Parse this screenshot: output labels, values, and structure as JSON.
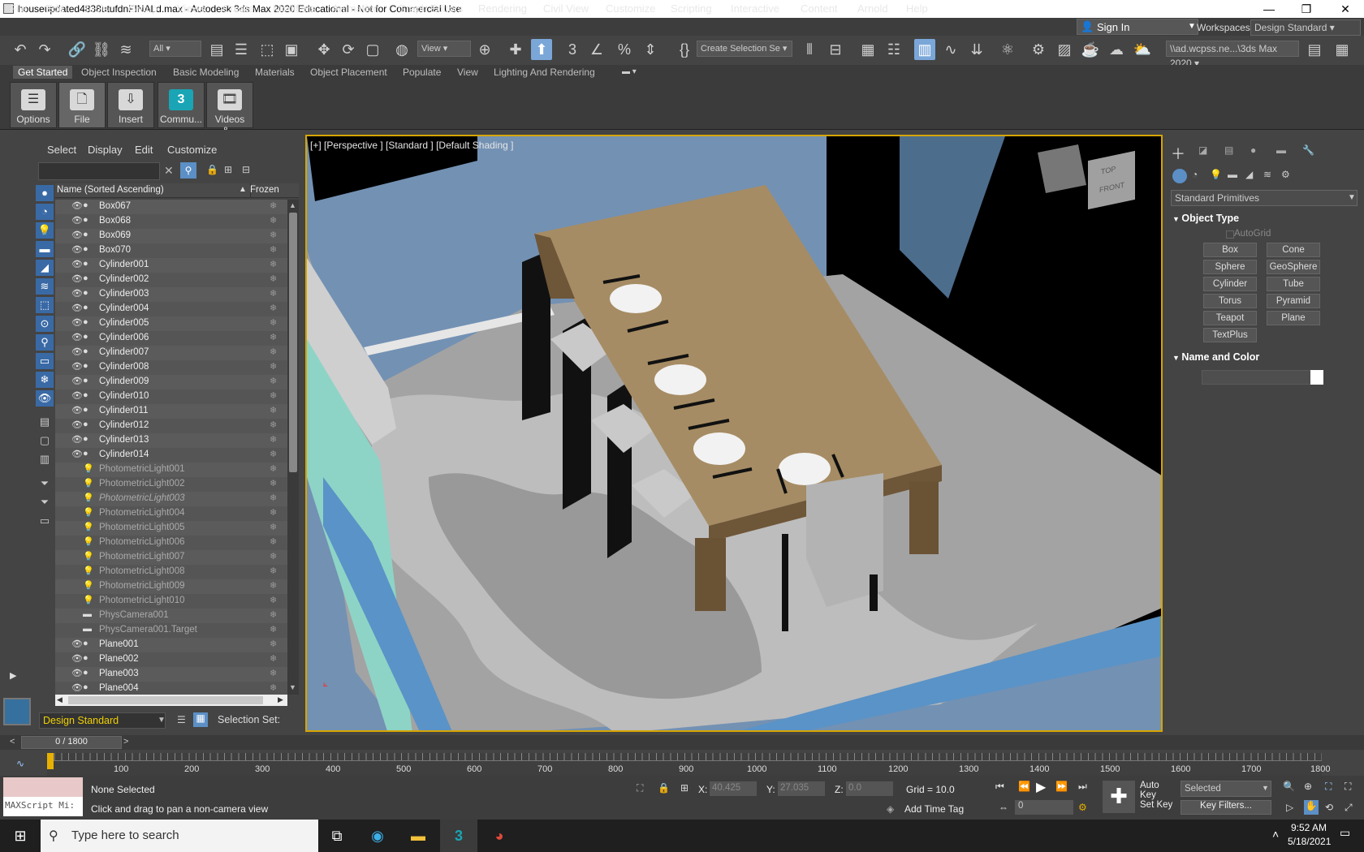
{
  "window": {
    "title": "houseupdated4838utufdnFINALd.max - Autodesk 3ds Max 2020 Educational - Not for Commercial Use"
  },
  "menu": [
    "File",
    "Edit",
    "Tools",
    "Group",
    "Views",
    "Create",
    "Modifiers",
    "Animation",
    "Graph Editors",
    "Rendering",
    "Civil View",
    "Customize",
    "Scripting",
    "Interactive",
    "Content",
    "Arnold",
    "Help"
  ],
  "account": {
    "signin": "Sign In",
    "workspaces_label": "Workspaces:",
    "workspace": "Design Standard"
  },
  "toolbar": {
    "selection_filter": "All",
    "ref_coord": "View",
    "named_selection": "Create Selection Se",
    "project_path": "\\\\ad.wcpss.ne...\\3ds Max 2020"
  },
  "ribbon": {
    "tabs": [
      "Get Started",
      "Object Inspection",
      "Basic Modeling",
      "Materials",
      "Object Placement",
      "Populate",
      "View",
      "Lighting And Rendering"
    ],
    "buttons": [
      "Options",
      "File",
      "Insert",
      "Commu...",
      "Videos &..."
    ]
  },
  "scene_explorer": {
    "tabs": [
      "Select",
      "Display",
      "Edit",
      "Customize"
    ],
    "col_name": "Name (Sorted Ascending)",
    "col_frozen": "Frozen",
    "rows": [
      {
        "name": "Box067",
        "type": "geo"
      },
      {
        "name": "Box068",
        "type": "geo"
      },
      {
        "name": "Box069",
        "type": "geo"
      },
      {
        "name": "Box070",
        "type": "geo"
      },
      {
        "name": "Cylinder001",
        "type": "geo"
      },
      {
        "name": "Cylinder002",
        "type": "geo"
      },
      {
        "name": "Cylinder003",
        "type": "geo"
      },
      {
        "name": "Cylinder004",
        "type": "geo"
      },
      {
        "name": "Cylinder005",
        "type": "geo"
      },
      {
        "name": "Cylinder006",
        "type": "geo"
      },
      {
        "name": "Cylinder007",
        "type": "geo"
      },
      {
        "name": "Cylinder008",
        "type": "geo"
      },
      {
        "name": "Cylinder009",
        "type": "geo"
      },
      {
        "name": "Cylinder010",
        "type": "geo"
      },
      {
        "name": "Cylinder011",
        "type": "geo"
      },
      {
        "name": "Cylinder012",
        "type": "geo"
      },
      {
        "name": "Cylinder013",
        "type": "geo"
      },
      {
        "name": "Cylinder014",
        "type": "geo"
      },
      {
        "name": "PhotometricLight001",
        "type": "light"
      },
      {
        "name": "PhotometricLight002",
        "type": "light"
      },
      {
        "name": "PhotometricLight003",
        "type": "light-it"
      },
      {
        "name": "PhotometricLight004",
        "type": "light"
      },
      {
        "name": "PhotometricLight005",
        "type": "light"
      },
      {
        "name": "PhotometricLight006",
        "type": "light"
      },
      {
        "name": "PhotometricLight007",
        "type": "light"
      },
      {
        "name": "PhotometricLight008",
        "type": "light"
      },
      {
        "name": "PhotometricLight009",
        "type": "light"
      },
      {
        "name": "PhotometricLight010",
        "type": "light"
      },
      {
        "name": "PhysCamera001",
        "type": "cam"
      },
      {
        "name": "PhysCamera001.Target",
        "type": "cam"
      },
      {
        "name": "Plane001",
        "type": "geo"
      },
      {
        "name": "Plane002",
        "type": "geo"
      },
      {
        "name": "Plane003",
        "type": "geo"
      },
      {
        "name": "Plane004",
        "type": "geo"
      }
    ],
    "layer": "Design Standard",
    "selection_set": "Selection Set:"
  },
  "viewport": {
    "label": "[+] [Perspective ] [Standard ] [Default Shading ]",
    "cube_top": "TOP",
    "cube_front": "FRONT"
  },
  "command_panel": {
    "category": "Standard Primitives",
    "object_type": "Object Type",
    "autogrid": "AutoGrid",
    "buttons": [
      "Box",
      "Cone",
      "Sphere",
      "GeoSphere",
      "Cylinder",
      "Tube",
      "Torus",
      "Pyramid",
      "Teapot",
      "Plane",
      "TextPlus"
    ],
    "name_color": "Name and Color"
  },
  "timeline": {
    "frame": "0 / 1800",
    "ticks": [
      "100",
      "200",
      "300",
      "400",
      "500",
      "600",
      "700",
      "800",
      "900",
      "1000",
      "1100",
      "1200",
      "1300",
      "1400",
      "1500",
      "1600",
      "1700",
      "1800"
    ]
  },
  "status": {
    "maxscript": "MAXScript Mi:",
    "selected": "None Selected",
    "prompt": "Click and drag to pan a non-camera view",
    "x_label": "X:",
    "x": "40.425",
    "y_label": "Y:",
    "y": "27.035",
    "z_label": "Z:",
    "z": "0.0",
    "grid": "Grid = 10.0",
    "add_time_tag": "Add Time Tag",
    "auto_key": "Auto Key",
    "set_key": "Set Key",
    "key_mode": "Selected",
    "key_filters": "Key Filters...",
    "frame_field": "0"
  },
  "taskbar": {
    "search": "Type here to search",
    "time": "9:52 AM",
    "date": "5/18/2021"
  }
}
